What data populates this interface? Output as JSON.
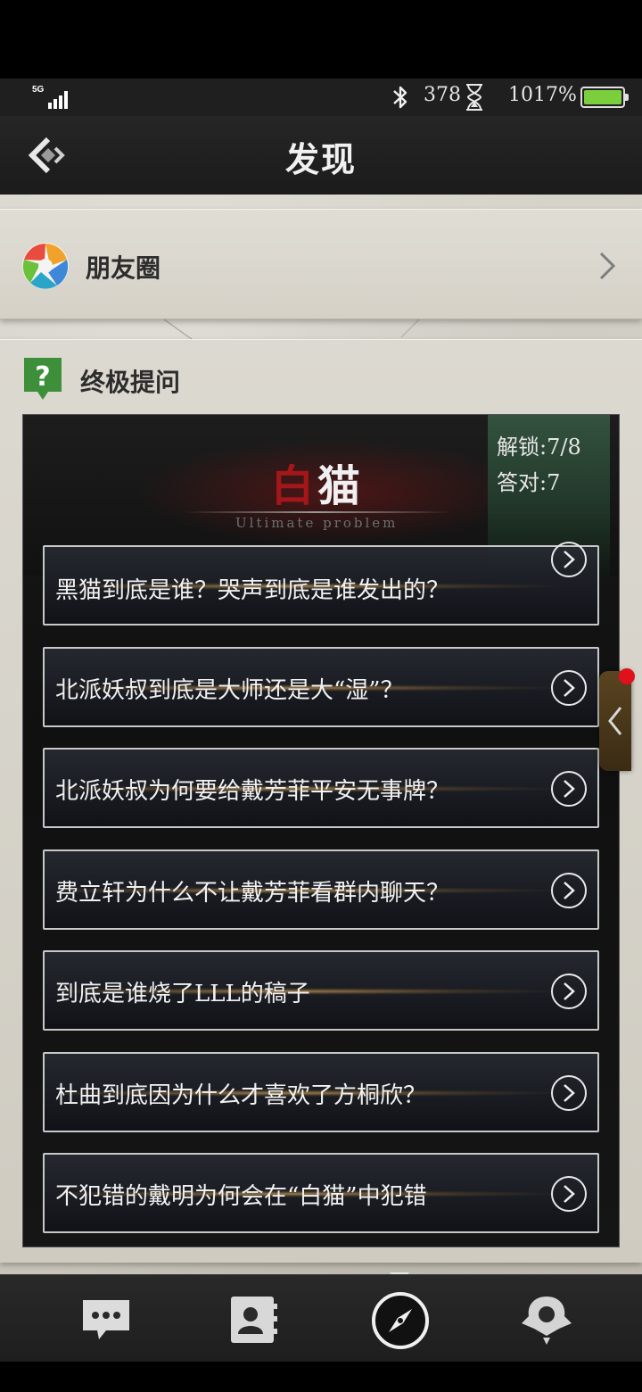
{
  "status_bar": {
    "network": "5G",
    "steps": "378",
    "battery_text": "1017%",
    "battery_color": "#7ccf3c",
    "icons": [
      "signal-icon",
      "bluetooth-icon",
      "hourglass-icon",
      "battery-icon"
    ]
  },
  "nav": {
    "title": "发现",
    "back_icon": "back-arrow-icon"
  },
  "moments": {
    "label": "朋友圈",
    "icon": "moments-aperture-icon"
  },
  "ultimate": {
    "label": "终极提问",
    "icon": "question-mark-icon",
    "banner": {
      "title_red": "白",
      "title_white": "猫",
      "subtitle": "Ultimate problem"
    },
    "stats": {
      "unlocked": "解锁:7/8",
      "correct": "答对:7"
    },
    "questions": [
      "黑猫到底是谁？哭声到底是谁发出的？",
      "北派妖叔到底是大师还是大“湿”？",
      "北派妖叔为何要给戴芳菲平安无事牌？",
      "费立轩为什么不让戴芳菲看群内聊天？",
      "到底是谁烧了LLL的稿子",
      "杜曲到底因为什么才喜欢了方桐欣？",
      "不犯错的戴明为何会在“白猫”中犯错"
    ]
  },
  "tabbar": {
    "tabs": [
      "chat-tab-icon",
      "contacts-tab-icon",
      "discover-compass-icon",
      "me-tab-icon"
    ],
    "active_index": 2
  },
  "colors": {
    "accent_red": "#a3171a",
    "stats_green": "#34523f",
    "badge_red": "#e0111a"
  }
}
